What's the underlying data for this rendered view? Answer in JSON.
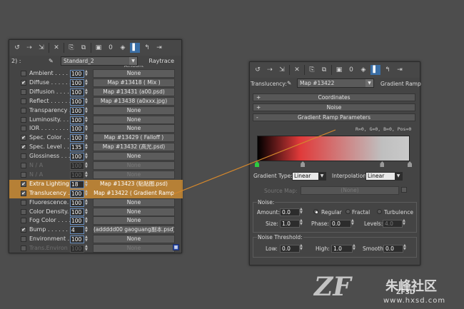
{
  "left_panel": {
    "toolbar_icons": [
      "get-material-icon",
      "put-material-icon",
      "assign-icon",
      "reset-icon",
      "copy-icon",
      "unique-icon",
      "put-library-icon",
      "material-id-icon",
      "show-map-icon",
      "show-end-result-icon",
      "go-to-parent-icon",
      "go-forward-icon"
    ],
    "material_id": "0",
    "prefix": "2) :",
    "shader_name": "Standard_2",
    "type_button": "Raytrace",
    "column_header": "Amount",
    "rows": [
      {
        "name": "Ambient . . . . . .",
        "amount": "100",
        "map": "None",
        "checked": false,
        "disabled": false,
        "highlight": false
      },
      {
        "name": "Diffuse . . . . . .",
        "amount": "100",
        "map": "Map #13418  ( Mix )",
        "checked": true,
        "disabled": false,
        "highlight": false
      },
      {
        "name": "Diffusion . . . . .",
        "amount": "100",
        "map": "Map #13431 (a00.psd)",
        "checked": false,
        "disabled": false,
        "highlight": false
      },
      {
        "name": "Reflect . . . . . .",
        "amount": "100",
        "map": "Map #13438 (a0xxx.jpg)",
        "checked": false,
        "disabled": false,
        "highlight": false
      },
      {
        "name": "Transparency . .",
        "amount": "100",
        "map": "None",
        "checked": false,
        "disabled": false,
        "highlight": false
      },
      {
        "name": "Luminosity. . . . .",
        "amount": "100",
        "map": "None",
        "checked": false,
        "disabled": false,
        "highlight": false
      },
      {
        "name": "IOR . . . . . . . .",
        "amount": "100",
        "map": "None",
        "checked": false,
        "disabled": false,
        "highlight": false
      },
      {
        "name": "Spec. Color . . .",
        "amount": "100",
        "map": "Map #13429  ( Falloff )",
        "checked": true,
        "disabled": false,
        "highlight": false
      },
      {
        "name": "Spec. Level . . .",
        "amount": "135",
        "map": "Map #13432 (高光.psd)",
        "checked": true,
        "disabled": false,
        "highlight": false
      },
      {
        "name": "Glossiness . . . .",
        "amount": "100",
        "map": "None",
        "checked": false,
        "disabled": false,
        "highlight": false
      },
      {
        "name": "N / A",
        "amount": "100",
        "map": "None",
        "checked": false,
        "disabled": true,
        "highlight": false
      },
      {
        "name": "N / A",
        "amount": "100",
        "map": "None",
        "checked": false,
        "disabled": true,
        "highlight": false
      },
      {
        "name": "Extra Lighting . .",
        "amount": "18",
        "map": "Map #13423 (贴贴图.psd)",
        "checked": true,
        "disabled": false,
        "highlight": true
      },
      {
        "name": "Translucency . .",
        "amount": "100",
        "map": "Map #13422  ( Gradient Ramp",
        "checked": true,
        "disabled": false,
        "highlight": true
      },
      {
        "name": "Fluorescence. . .",
        "amount": "100",
        "map": "None",
        "checked": false,
        "disabled": false,
        "highlight": false
      },
      {
        "name": "Color Density. . .",
        "amount": "100",
        "map": "None",
        "checked": false,
        "disabled": false,
        "highlight": false
      },
      {
        "name": "Fog Color . . . . .",
        "amount": "100",
        "map": "None",
        "checked": false,
        "disabled": false,
        "highlight": false
      },
      {
        "name": "Bump . . . . . . .",
        "amount": "4",
        "map": "(addddd00 gaoguang副本.psd)",
        "checked": true,
        "disabled": false,
        "highlight": false
      },
      {
        "name": "Environment . . .",
        "amount": "100",
        "map": "None",
        "checked": false,
        "disabled": false,
        "highlight": false
      },
      {
        "name": "Trans.Environ . .",
        "amount": "100",
        "map": "None",
        "checked": false,
        "disabled": true,
        "highlight": false
      }
    ]
  },
  "right_panel": {
    "material_id": "0",
    "slot_label": "Translucency:",
    "map_name": "Map #13422",
    "map_type": "Gradient Ramp",
    "rollouts": [
      {
        "sign": "+",
        "label": "Coordinates"
      },
      {
        "sign": "+",
        "label": "Noise"
      },
      {
        "sign": "-",
        "label": "Gradient Ramp Parameters"
      }
    ],
    "rgb_readout": "R=0, G=0, B=0,  Pos=0",
    "gradient_stops": [
      {
        "pos": 0.0,
        "color": "#000000"
      },
      {
        "pos": 0.28,
        "color": "#e03a3a"
      },
      {
        "pos": 0.82,
        "color": "#bfbfbf"
      },
      {
        "pos": 1.0,
        "color": "#c9c9c9"
      }
    ],
    "flags": [
      0.0,
      0.3,
      0.82,
      1.0
    ],
    "gradient_type_label": "Gradient Type:",
    "gradient_type": "Linear",
    "interpolation_label": "Interpolation:",
    "interpolation": "Linear",
    "source_map_label": "Source Map:",
    "source_map_value": "(None)",
    "noise_group": "Noise:",
    "amount_label": "Amount:",
    "amount_value": "0.0",
    "radio_options": [
      "Regular",
      "Fractal",
      "Turbulence"
    ],
    "size_label": "Size:",
    "size_value": "1.0",
    "phase_label": "Phase:",
    "phase_value": "0.0",
    "levels_label": "Levels:",
    "levels_value": "4.0",
    "threshold_group": "Noise Threshold:",
    "low_label": "Low:",
    "low_value": "0.0",
    "high_label": "High:",
    "high_value": "1.0",
    "smooth_label": "Smooth:",
    "smooth_value": "0.0"
  },
  "watermark": {
    "site_cn": "朱峰社区",
    "site_url": "www.hxsd.com",
    "logo_text": "ZF3D"
  },
  "colors": {
    "highlight": "#d69132",
    "connector": "#d6882c",
    "active_button": "#3a6ea5"
  }
}
